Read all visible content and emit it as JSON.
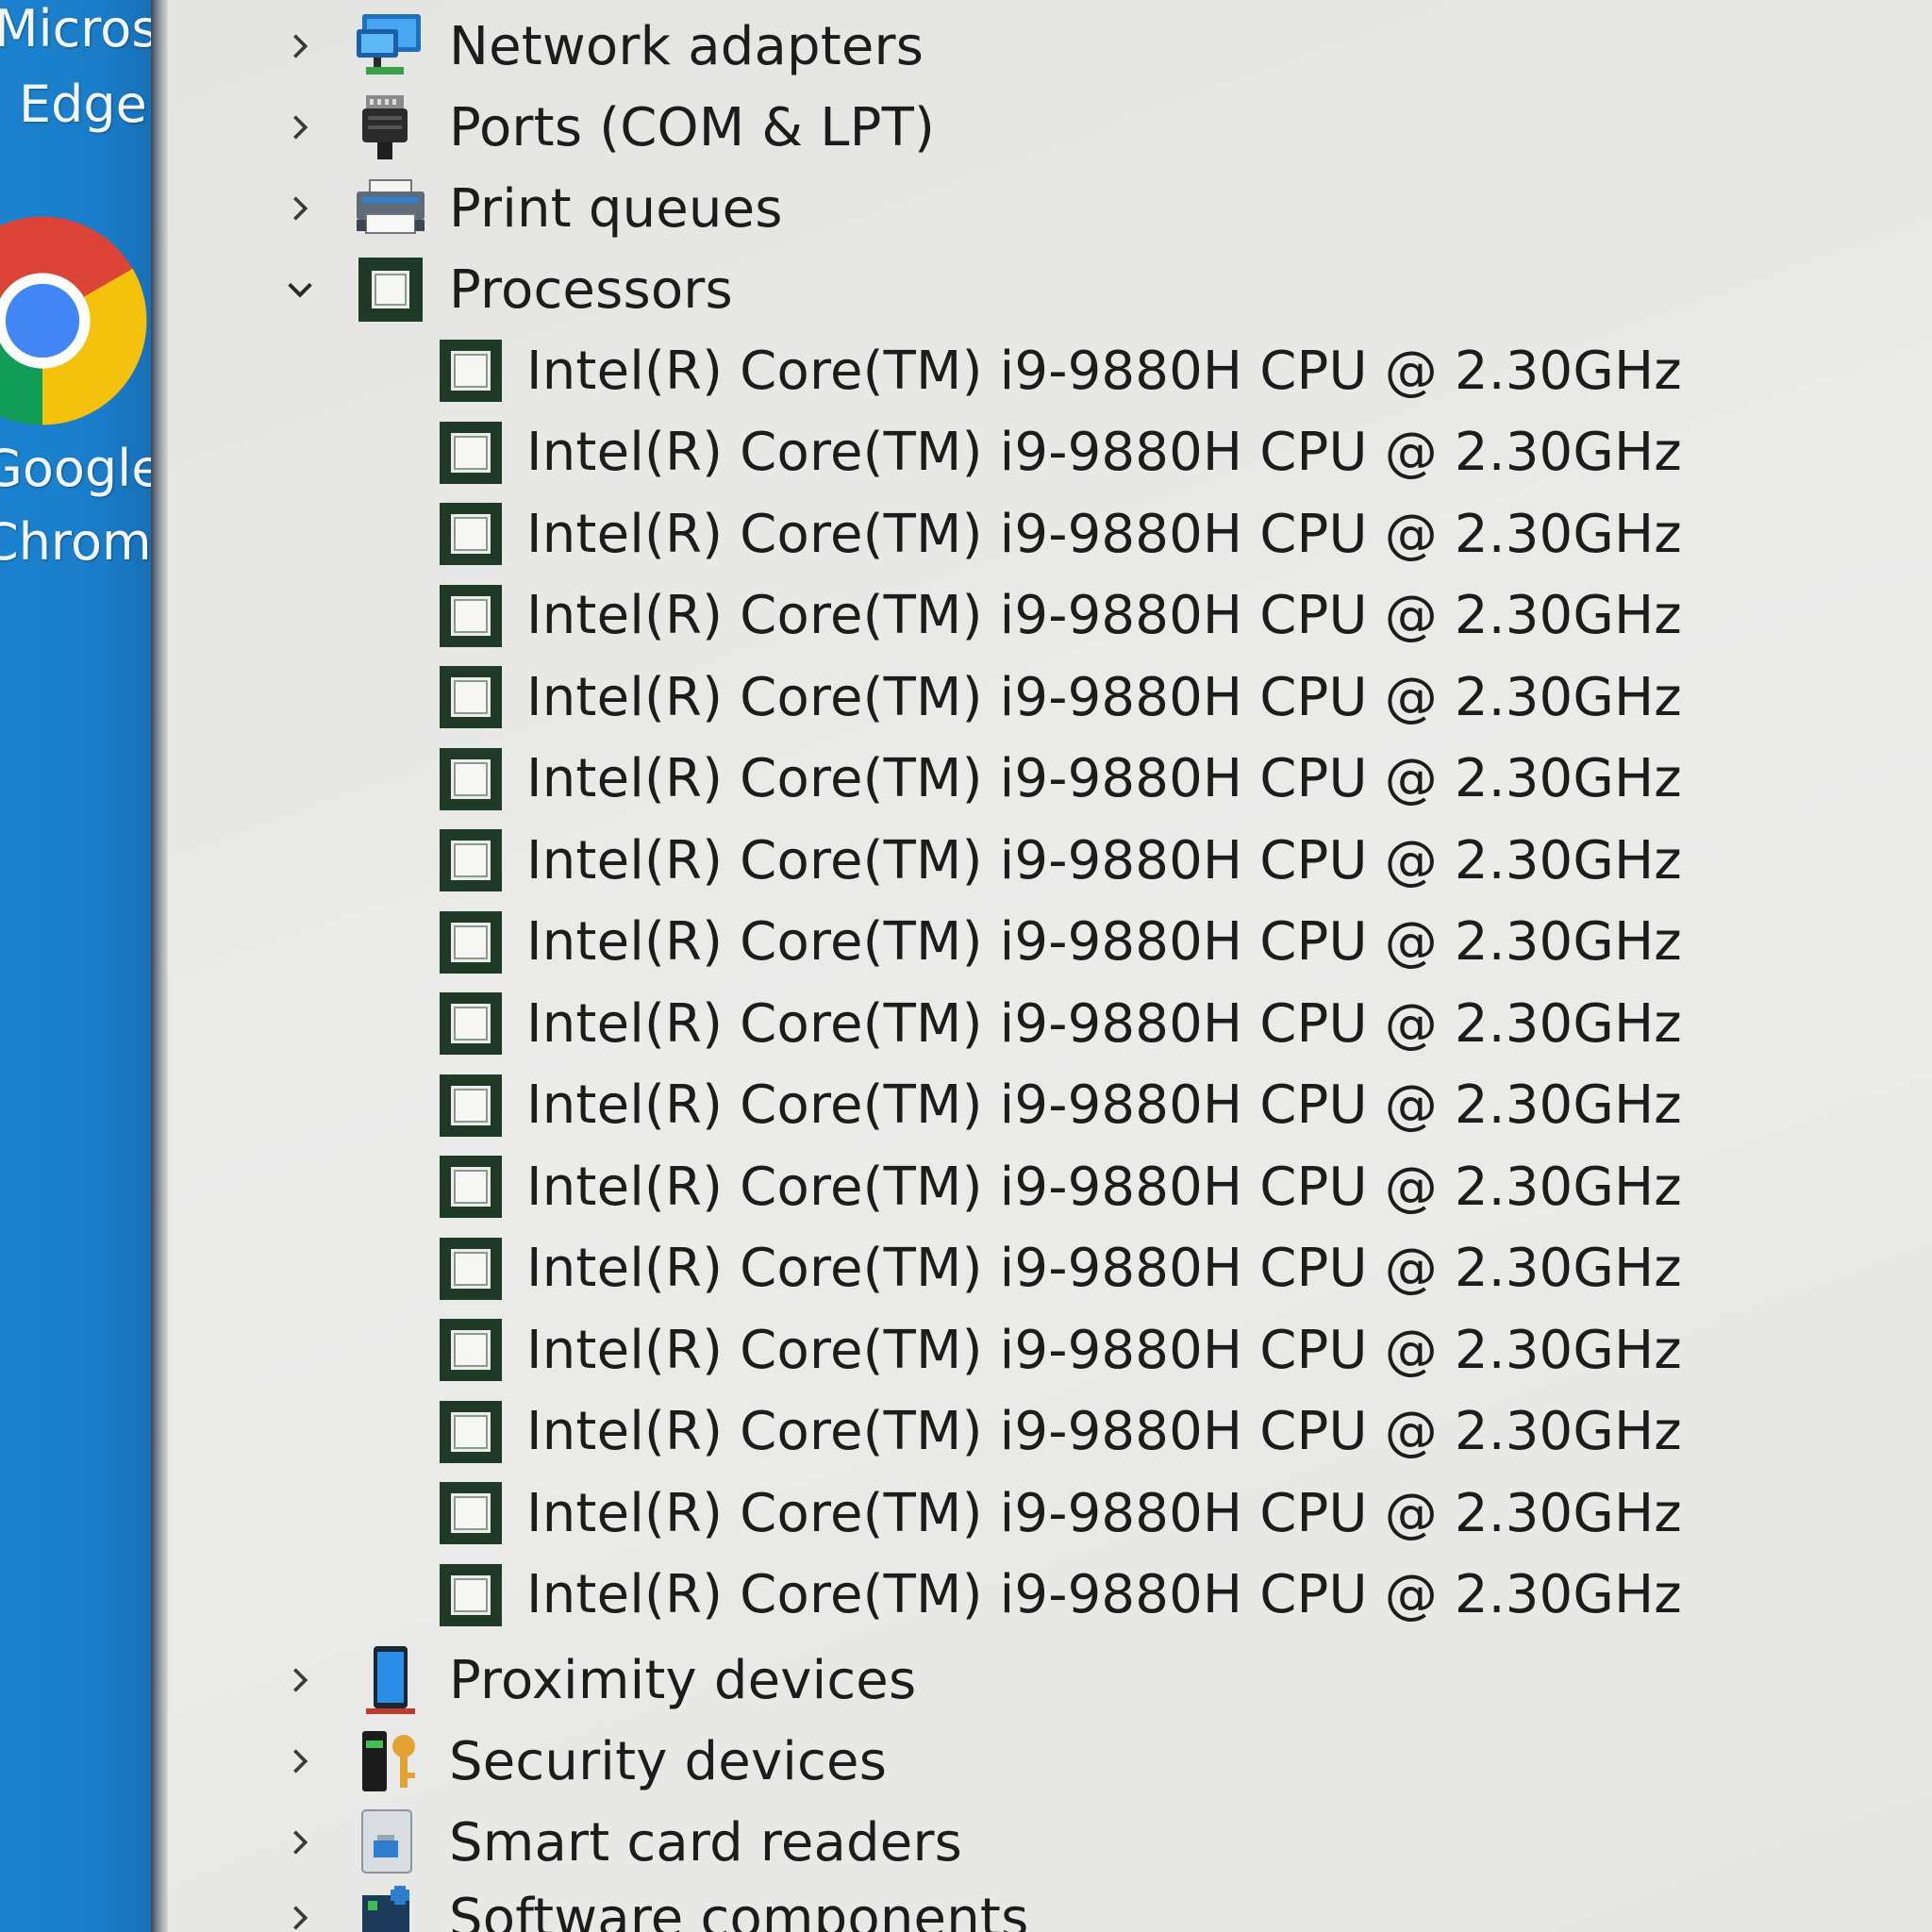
{
  "desktop": {
    "icons": [
      {
        "label_line1": "Microsoft",
        "label_line2": "Edge"
      },
      {
        "label_line1": "Google",
        "label_line2": "Chrome"
      }
    ]
  },
  "tree": {
    "categories_above": [
      {
        "label": "Network adapters",
        "expanded": false,
        "icon": "network-adapter-icon"
      },
      {
        "label": "Ports (COM & LPT)",
        "expanded": false,
        "icon": "port-icon"
      },
      {
        "label": "Print queues",
        "expanded": false,
        "icon": "printer-icon"
      }
    ],
    "processors": {
      "label": "Processors",
      "expanded": true,
      "icon": "processor-icon",
      "children": [
        "Intel(R) Core(TM) i9-9880H CPU @ 2.30GHz",
        "Intel(R) Core(TM) i9-9880H CPU @ 2.30GHz",
        "Intel(R) Core(TM) i9-9880H CPU @ 2.30GHz",
        "Intel(R) Core(TM) i9-9880H CPU @ 2.30GHz",
        "Intel(R) Core(TM) i9-9880H CPU @ 2.30GHz",
        "Intel(R) Core(TM) i9-9880H CPU @ 2.30GHz",
        "Intel(R) Core(TM) i9-9880H CPU @ 2.30GHz",
        "Intel(R) Core(TM) i9-9880H CPU @ 2.30GHz",
        "Intel(R) Core(TM) i9-9880H CPU @ 2.30GHz",
        "Intel(R) Core(TM) i9-9880H CPU @ 2.30GHz",
        "Intel(R) Core(TM) i9-9880H CPU @ 2.30GHz",
        "Intel(R) Core(TM) i9-9880H CPU @ 2.30GHz",
        "Intel(R) Core(TM) i9-9880H CPU @ 2.30GHz",
        "Intel(R) Core(TM) i9-9880H CPU @ 2.30GHz",
        "Intel(R) Core(TM) i9-9880H CPU @ 2.30GHz",
        "Intel(R) Core(TM) i9-9880H CPU @ 2.30GHz"
      ]
    },
    "categories_below": [
      {
        "label": "Proximity devices",
        "expanded": false,
        "icon": "proximity-device-icon"
      },
      {
        "label": "Security devices",
        "expanded": false,
        "icon": "security-device-icon"
      },
      {
        "label": "Smart card readers",
        "expanded": false,
        "icon": "smart-card-reader-icon"
      },
      {
        "label": "Software components",
        "expanded": false,
        "icon": "software-component-icon"
      }
    ]
  },
  "colors": {
    "desktop_blue": "#1a7cc8",
    "tree_background": "#e8e8e6",
    "text": "#1c1c1c",
    "processor_icon_green": "#1f3a26"
  }
}
